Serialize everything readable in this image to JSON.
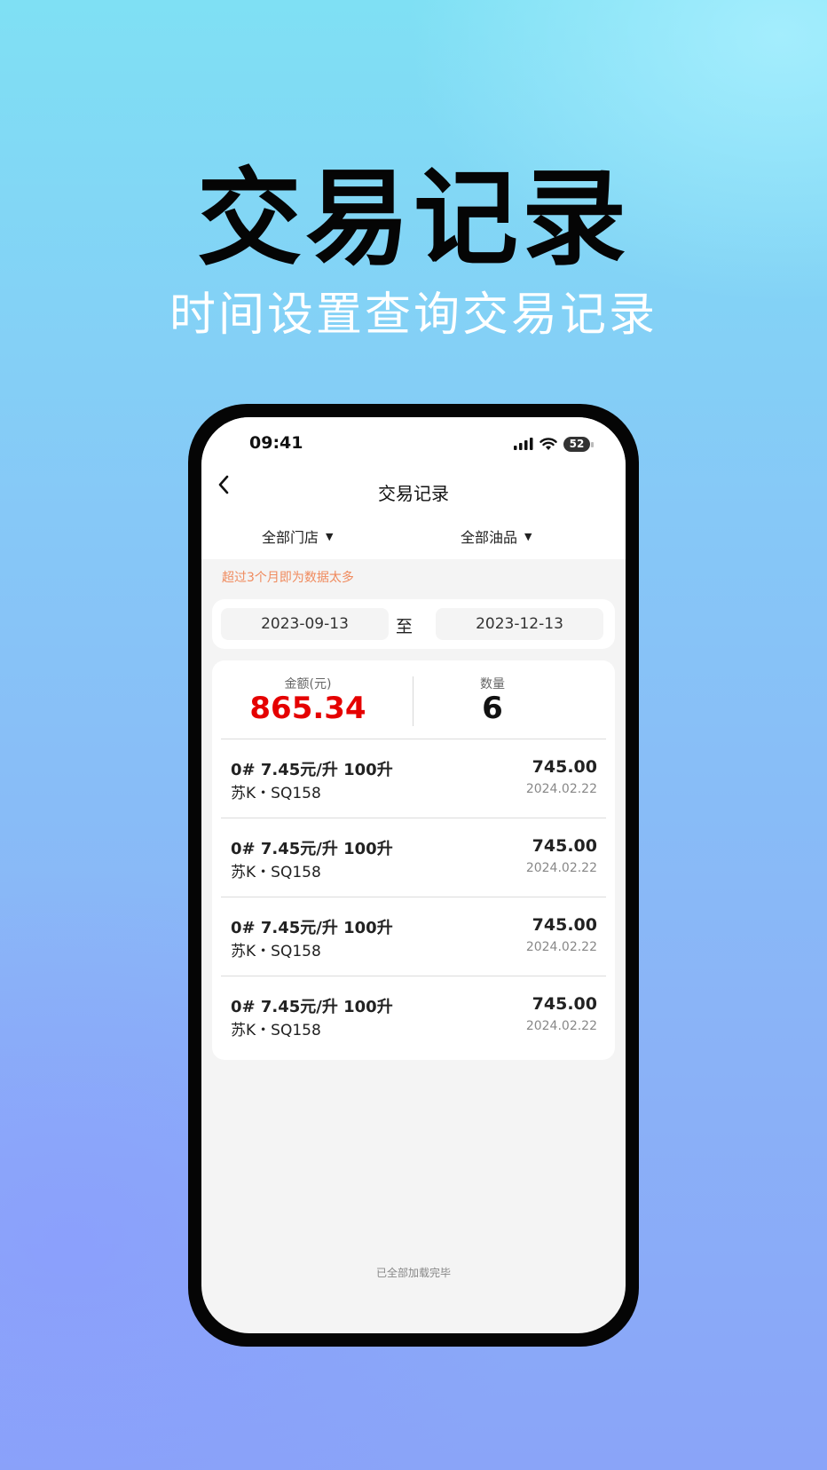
{
  "hero": {
    "title": "交易记录",
    "subtitle": "时间设置查询交易记录"
  },
  "status_bar": {
    "time": "09:41",
    "battery": "52",
    "icons": [
      "signal-icon",
      "wifi-icon",
      "battery-icon"
    ]
  },
  "nav": {
    "title": "交易记录",
    "back_icon": "chevron-left-icon"
  },
  "filters": {
    "store": "全部门店",
    "oil": "全部油品"
  },
  "notice": "超过3个月即为数据太多",
  "date_range": {
    "start": "2023-09-13",
    "separator": "至",
    "end": "2023-12-13"
  },
  "summary": {
    "amount_label": "金额(元)",
    "amount": "865.34",
    "count_label": "数量",
    "count": "6"
  },
  "transactions": [
    {
      "spec": "0# 7.45元/升 100升",
      "plate": "苏K・SQ158",
      "amount": "745.00",
      "date": "2024.02.22"
    },
    {
      "spec": "0# 7.45元/升 100升",
      "plate": "苏K・SQ158",
      "amount": "745.00",
      "date": "2024.02.22"
    },
    {
      "spec": "0# 7.45元/升 100升",
      "plate": "苏K・SQ158",
      "amount": "745.00",
      "date": "2024.02.22"
    },
    {
      "spec": "0# 7.45元/升 100升",
      "plate": "苏K・SQ158",
      "amount": "745.00",
      "date": "2024.02.22"
    }
  ],
  "footer": "已全部加载完毕",
  "colors": {
    "accent_red": "#e50000",
    "notice_orange": "#f08a5d",
    "background_top": "#7fe0f4",
    "background_bottom": "#8aa4f8"
  }
}
